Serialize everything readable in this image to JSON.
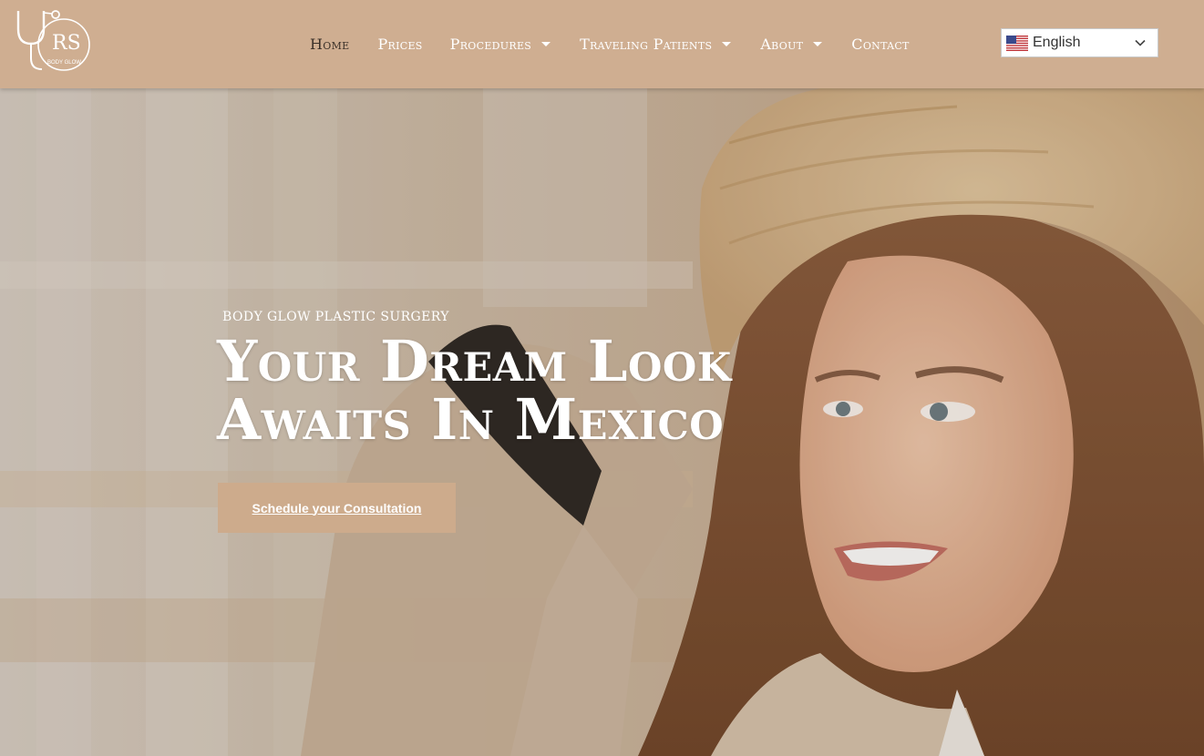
{
  "header": {
    "logo": {
      "monogram": "RS",
      "brand": "BODY GLOW"
    },
    "nav": [
      {
        "label": "Home",
        "has_dropdown": false,
        "active": true
      },
      {
        "label": "Prices",
        "has_dropdown": false,
        "active": false
      },
      {
        "label": "Procedures",
        "has_dropdown": true,
        "active": false
      },
      {
        "label": "Traveling Patients",
        "has_dropdown": true,
        "active": false
      },
      {
        "label": "About",
        "has_dropdown": true,
        "active": false
      },
      {
        "label": "Contact",
        "has_dropdown": false,
        "active": false
      }
    ],
    "language": {
      "selected": "English",
      "flag_icon": "us-flag-icon",
      "chevron_icon": "chevron-down-icon"
    }
  },
  "hero": {
    "eyebrow": "BODY GLOW PLASTIC SURGERY",
    "title_line1": "Your Dream Look",
    "title_line2": "Awaits In Mexico",
    "cta_label": "Schedule your Consultation"
  },
  "colors": {
    "header_bg": "#cfae91",
    "cta_bg": "#cdab8c",
    "active_nav": "#3b3129",
    "nav_text": "#ffffff"
  }
}
